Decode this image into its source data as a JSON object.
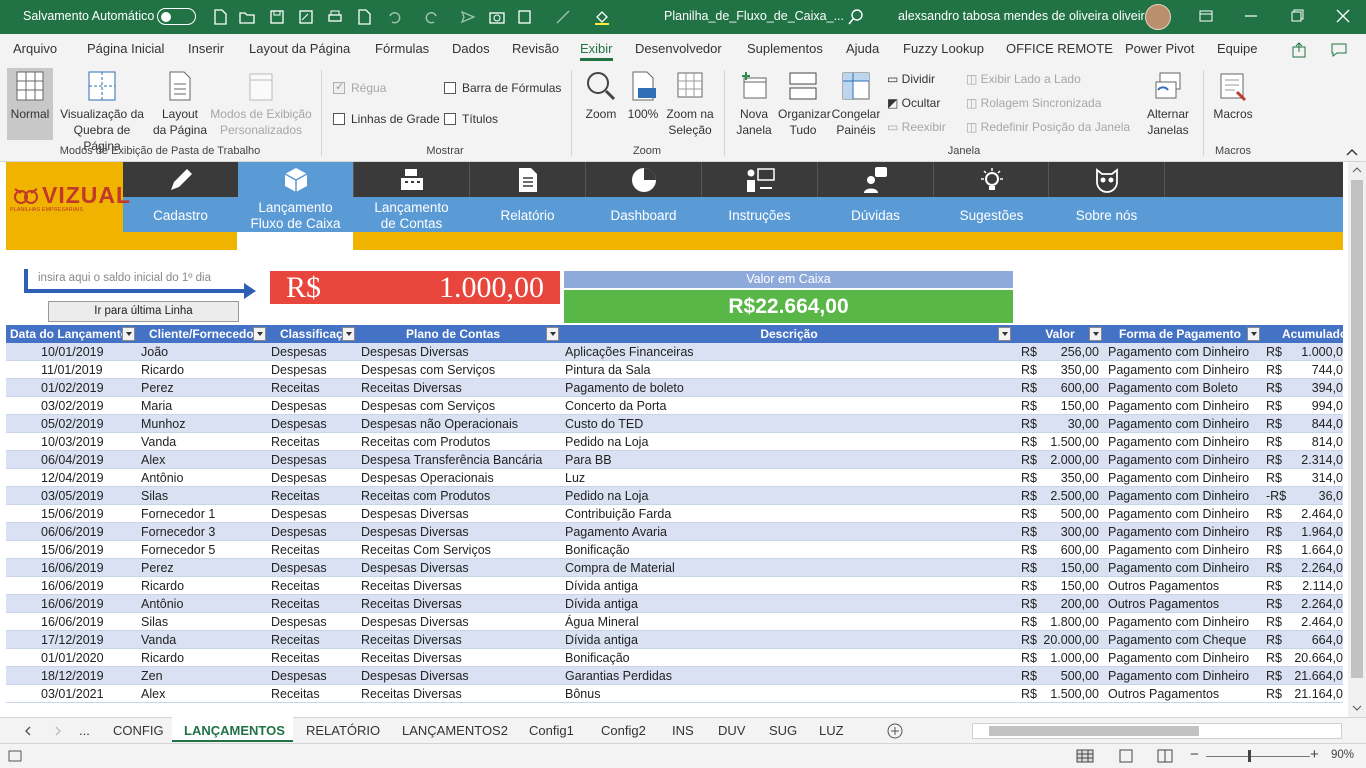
{
  "titlebar": {
    "autosave_label": "Salvamento Automático",
    "filename": "Planilha_de_Fluxo_de_Caixa_...",
    "user": "alexsandro tabosa mendes de oliveira oliveira"
  },
  "ribbon_tabs": [
    "Arquivo",
    "Página Inicial",
    "Inserir",
    "Layout da Página",
    "Fórmulas",
    "Dados",
    "Revisão",
    "Exibir",
    "Desenvolvedor",
    "Suplementos",
    "Ajuda",
    "Fuzzy Lookup",
    "OFFICE REMOTE",
    "Power Pivot",
    "Equipe"
  ],
  "active_tab": "Exibir",
  "ribbon": {
    "views": {
      "normal": "Normal",
      "page_break": "Visualização da\nQuebra de Página",
      "page_layout": "Layout\nda Página",
      "custom": "Modos de Exibição\nPersonalizados",
      "group": "Modos de Exibição de Pasta de Trabalho"
    },
    "show": {
      "ruler": "Régua",
      "gridlines": "Linhas de Grade",
      "formula_bar": "Barra de Fórmulas",
      "headings": "Títulos",
      "group": "Mostrar"
    },
    "zoom": {
      "zoom": "Zoom",
      "hundred": "100%",
      "zoom_selection": "Zoom na\nSeleção",
      "group": "Zoom"
    },
    "window": {
      "new_window": "Nova\nJanela",
      "arrange_all": "Organizar\nTudo",
      "freeze_panes": "Congelar\nPainéis",
      "split": "Dividir",
      "hide": "Ocultar",
      "unhide": "Reexibir",
      "side_by_side": "Exibir Lado a Lado",
      "sync_scroll": "Rolagem Sincronizada",
      "reset_position": "Redefinir Posição da Janela",
      "switch_windows": "Alternar\nJanelas",
      "group": "Janela"
    },
    "macros": {
      "macros": "Macros",
      "group": "Macros"
    }
  },
  "menu": {
    "logo_text": "VIZUAL",
    "logo_sub": "PLANILHAS EMPRESARIAIS",
    "items": [
      "Cadastro",
      "Lançamento\nFluxo de Caixa",
      "Lançamento\nde Contas",
      "Relatório",
      "Dashboard",
      "Instruções",
      "Dúvidas",
      "Sugestões",
      "Sobre nós"
    ]
  },
  "panel": {
    "hint": "insira aqui o saldo inicial do 1º dia",
    "last_line_button": "Ir para última Linha",
    "saldo_currency": "R$",
    "saldo_value": "1.000,00",
    "valor_caixa_label": "Valor em Caixa",
    "valor_caixa_value": "R$22.664,00"
  },
  "table": {
    "headers": [
      "Data do Lançamento",
      "Cliente/Fornecedor",
      "Classificação",
      "Plano de Contas",
      "Descrição",
      "Valor",
      "Forma de Pagamento",
      "Acumulado"
    ],
    "rows": [
      [
        "10/01/2019",
        "João",
        "Despesas",
        "Despesas Diversas",
        "Aplicações Financeiras",
        "R$",
        "256,00",
        "Pagamento com Dinheiro",
        "R$",
        "1.000,0"
      ],
      [
        "11/01/2019",
        "Ricardo",
        "Despesas",
        "Despesas com Serviços",
        "Pintura da Sala",
        "R$",
        "350,00",
        "Pagamento com Dinheiro",
        "R$",
        "744,0"
      ],
      [
        "01/02/2019",
        "Perez",
        "Receitas",
        "Receitas Diversas",
        "Pagamento de boleto",
        "R$",
        "600,00",
        "Pagamento com Boleto",
        "R$",
        "394,0"
      ],
      [
        "03/02/2019",
        "Maria",
        "Despesas",
        "Despesas com Serviços",
        "Concerto da Porta",
        "R$",
        "150,00",
        "Pagamento com Dinheiro",
        "R$",
        "994,0"
      ],
      [
        "05/02/2019",
        "Munhoz",
        "Despesas",
        "Despesas não Operacionais",
        "Custo do TED",
        "R$",
        "30,00",
        "Pagamento com Dinheiro",
        "R$",
        "844,0"
      ],
      [
        "10/03/2019",
        "Vanda",
        "Receitas",
        "Receitas com Produtos",
        "Pedido na Loja",
        "R$",
        "1.500,00",
        "Pagamento com Dinheiro",
        "R$",
        "814,0"
      ],
      [
        "06/04/2019",
        "Alex",
        "Despesas",
        "Despesa Transferência Bancária",
        "Para BB",
        "R$",
        "2.000,00",
        "Pagamento com Dinheiro",
        "R$",
        "2.314,0"
      ],
      [
        "12/04/2019",
        "Antônio",
        "Despesas",
        "Despesas Operacionais",
        "Luz",
        "R$",
        "350,00",
        "Pagamento com Dinheiro",
        "R$",
        "314,0"
      ],
      [
        "03/05/2019",
        "Silas",
        "Receitas",
        "Receitas com Produtos",
        "Pedido na Loja",
        "R$",
        "2.500,00",
        "Pagamento com Dinheiro",
        "-R$",
        "36,0"
      ],
      [
        "15/06/2019",
        "Fornecedor 1",
        "Despesas",
        "Despesas Diversas",
        "Contribuição Farda",
        "R$",
        "500,00",
        "Pagamento com Dinheiro",
        "R$",
        "2.464,0"
      ],
      [
        "06/06/2019",
        "Fornecedor 3",
        "Despesas",
        "Despesas Diversas",
        "Pagamento Avaria",
        "R$",
        "300,00",
        "Pagamento com Dinheiro",
        "R$",
        "1.964,0"
      ],
      [
        "15/06/2019",
        "Fornecedor 5",
        "Receitas",
        "Receitas Com Serviços",
        "Bonificação",
        "R$",
        "600,00",
        "Pagamento com Dinheiro",
        "R$",
        "1.664,0"
      ],
      [
        "16/06/2019",
        "Perez",
        "Despesas",
        "Despesas Diversas",
        "Compra de Material",
        "R$",
        "150,00",
        "Pagamento com Dinheiro",
        "R$",
        "2.264,0"
      ],
      [
        "16/06/2019",
        "Ricardo",
        "Receitas",
        "Receitas Diversas",
        "Dívida antiga",
        "R$",
        "150,00",
        "Outros Pagamentos",
        "R$",
        "2.114,0"
      ],
      [
        "16/06/2019",
        "Antônio",
        "Receitas",
        "Receitas Diversas",
        "Dívida antiga",
        "R$",
        "200,00",
        "Outros Pagamentos",
        "R$",
        "2.264,0"
      ],
      [
        "16/06/2019",
        "Silas",
        "Despesas",
        "Despesas Diversas",
        "Água Mineral",
        "R$",
        "1.800,00",
        "Pagamento com Dinheiro",
        "R$",
        "2.464,0"
      ],
      [
        "17/12/2019",
        "Vanda",
        "Receitas",
        "Receitas Diversas",
        "Dívida antiga",
        "R$",
        "20.000,00",
        "Pagamento com Cheque",
        "R$",
        "664,0"
      ],
      [
        "01/01/2020",
        "Ricardo",
        "Receitas",
        "Receitas Diversas",
        "Bonificação",
        "R$",
        "1.000,00",
        "Pagamento com Dinheiro",
        "R$",
        "20.664,0"
      ],
      [
        "18/12/2019",
        "Zen",
        "Despesas",
        "Despesas Diversas",
        "Garantias Perdidas",
        "R$",
        "500,00",
        "Pagamento com Dinheiro",
        "R$",
        "21.664,0"
      ],
      [
        "03/01/2021",
        "Alex",
        "Receitas",
        "Receitas Diversas",
        "Bônus",
        "R$",
        "1.500,00",
        "Outros Pagamentos",
        "R$",
        "21.164,0"
      ]
    ]
  },
  "sheet_tabs": [
    "...",
    "CONFIG",
    "LANÇAMENTOS",
    "RELATÓRIO",
    "LANÇAMENTOS2",
    "Config1",
    "Config2",
    "INS",
    "DUV",
    "SUG",
    "LUZ"
  ],
  "active_sheet": "LANÇAMENTOS",
  "status": {
    "zoom": "90%"
  }
}
